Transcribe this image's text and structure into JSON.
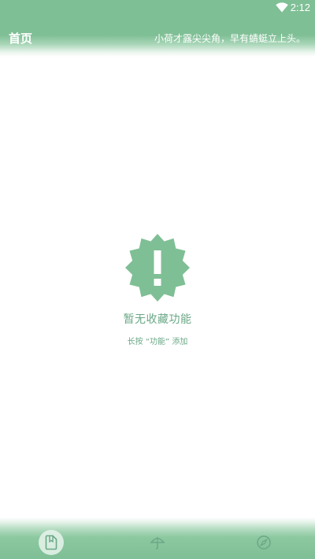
{
  "status_bar": {
    "time": "2:12",
    "wifi_icon": "wifi-icon"
  },
  "app_bar": {
    "title": "首页",
    "subtitle": "小荷才露尖尖角，早有蜻蜓立上头。"
  },
  "empty_state": {
    "icon": "alert-badge-icon",
    "title": "暂无收藏功能",
    "hint": "长按 “功能” 添加"
  },
  "bottom_nav": {
    "items": [
      {
        "icon": "bookmark-icon",
        "active": true
      },
      {
        "icon": "umbrella-icon",
        "active": false
      },
      {
        "icon": "compass-icon",
        "active": false
      }
    ]
  },
  "colors": {
    "primary": "#7fbf95",
    "accent_text": "#6aa886",
    "background": "#ffffff"
  }
}
